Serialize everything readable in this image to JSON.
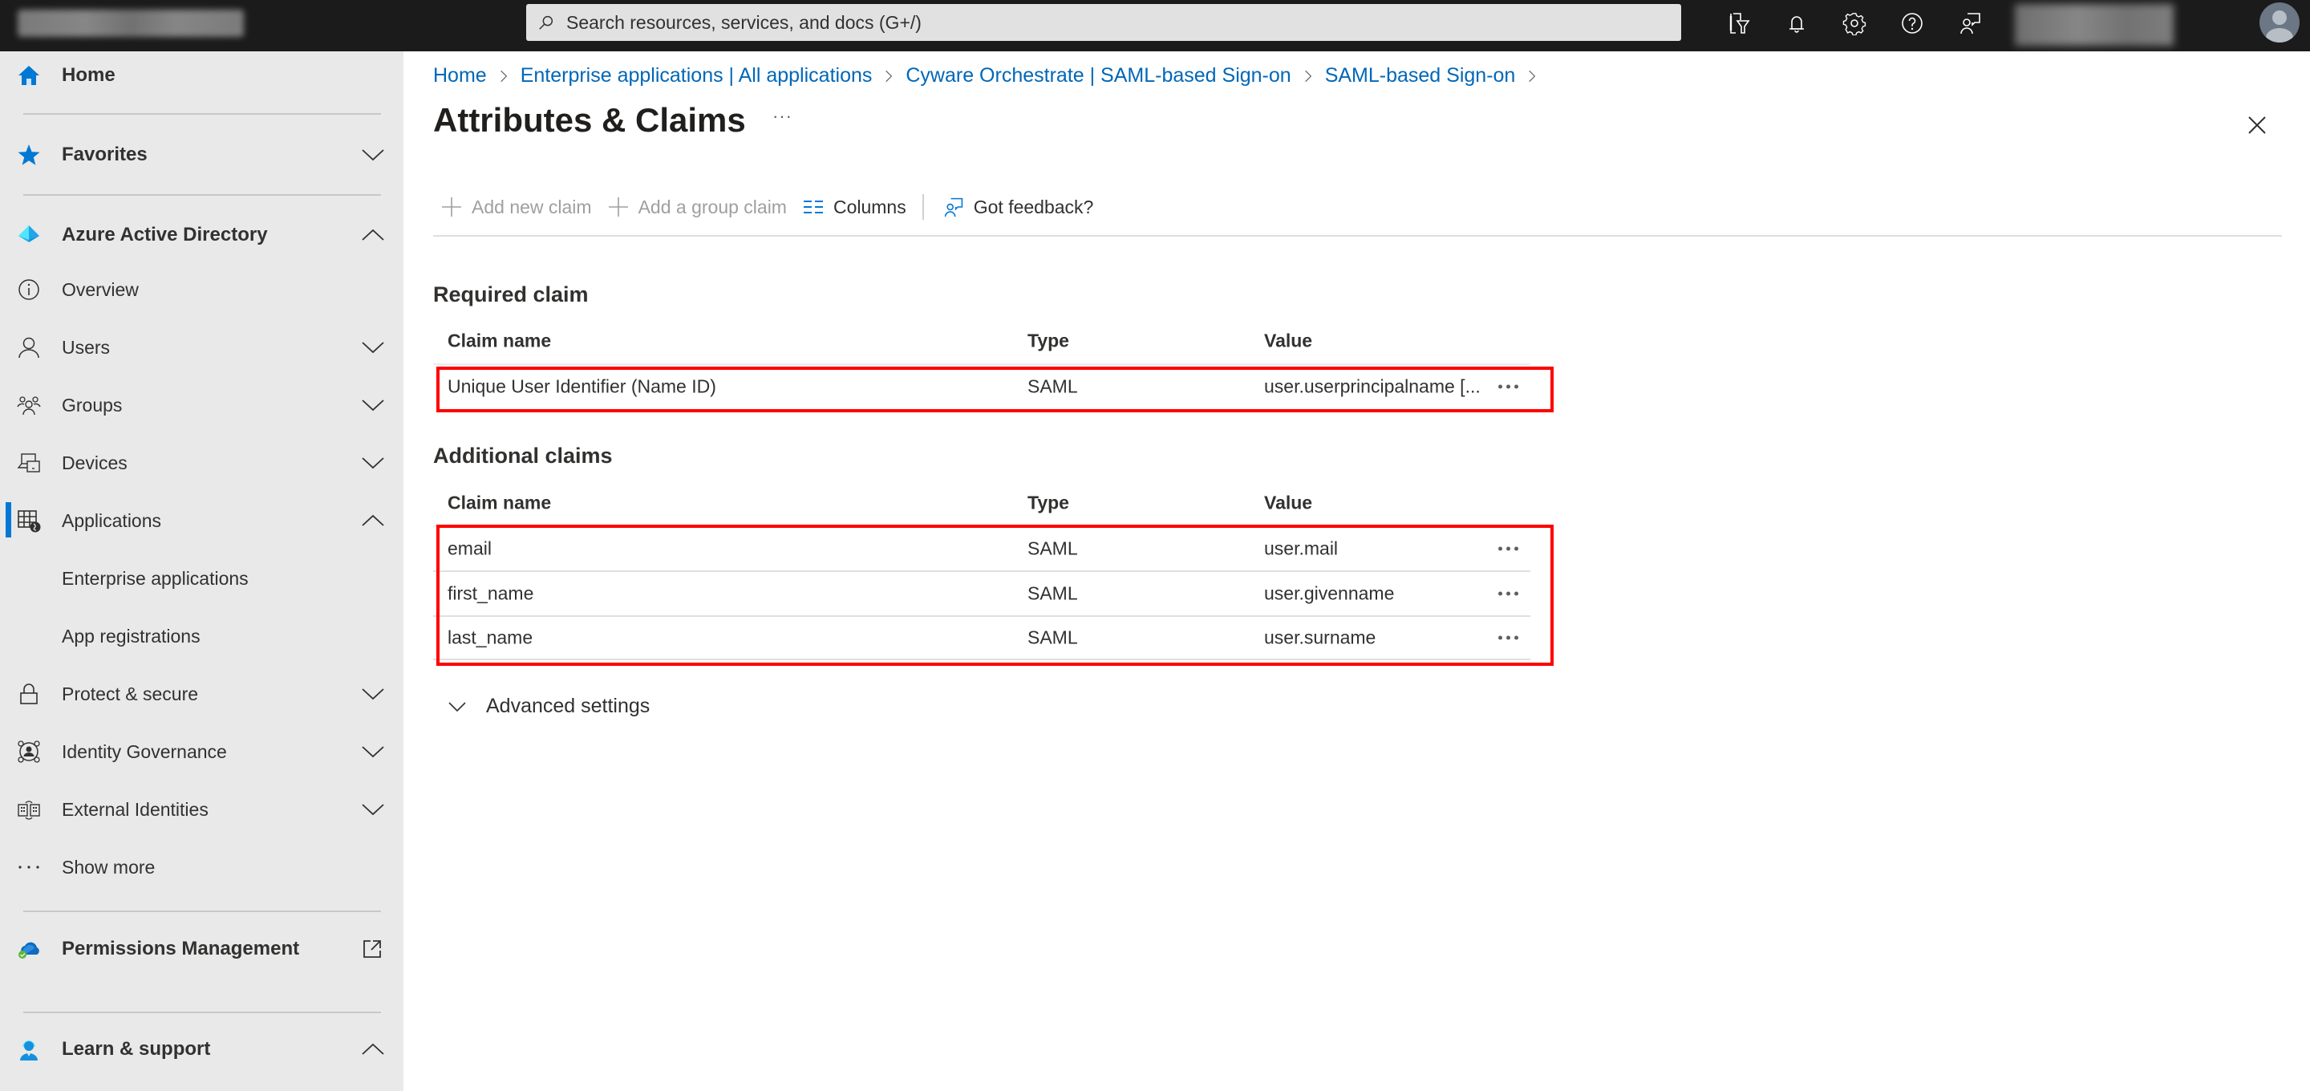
{
  "topbar": {
    "search_placeholder": "Search resources, services, and docs (G+/)",
    "icons": [
      "directory-filter-icon",
      "notification-bell-icon",
      "settings-gear-icon",
      "help-question-icon",
      "feedback-icon"
    ]
  },
  "sidebar": {
    "home": "Home",
    "favorites": "Favorites",
    "aad": "Azure Active Directory",
    "items": [
      {
        "label": "Overview",
        "icon": "info-icon",
        "chevron": "none"
      },
      {
        "label": "Users",
        "icon": "user-icon",
        "chevron": "down"
      },
      {
        "label": "Groups",
        "icon": "groups-icon",
        "chevron": "down"
      },
      {
        "label": "Devices",
        "icon": "devices-icon",
        "chevron": "down"
      },
      {
        "label": "Applications",
        "icon": "applications-icon",
        "chevron": "up",
        "selected": true
      },
      {
        "label": "Enterprise applications",
        "icon": "",
        "chevron": "none"
      },
      {
        "label": "App registrations",
        "icon": "",
        "chevron": "none"
      },
      {
        "label": "Protect & secure",
        "icon": "lock-icon",
        "chevron": "down"
      },
      {
        "label": "Identity Governance",
        "icon": "identity-governance-icon",
        "chevron": "down"
      },
      {
        "label": "External Identities",
        "icon": "external-identities-icon",
        "chevron": "down"
      },
      {
        "label": "Show more",
        "icon": "more-icon",
        "chevron": "none"
      }
    ],
    "permissions": "Permissions Management",
    "learn": "Learn & support"
  },
  "breadcrumb": [
    "Home",
    "Enterprise applications | All applications",
    "Cyware Orchestrate | SAML-based Sign-on",
    "SAML-based Sign-on"
  ],
  "page": {
    "title": "Attributes & Claims",
    "more": "···"
  },
  "toolbar": {
    "add_claim": "Add new claim",
    "add_group_claim": "Add a group claim",
    "columns": "Columns",
    "feedback": "Got feedback?"
  },
  "columns": {
    "name": "Claim name",
    "type": "Type",
    "value": "Value"
  },
  "required": {
    "title": "Required claim",
    "rows": [
      {
        "name": "Unique User Identifier (Name ID)",
        "type": "SAML",
        "value": "user.userprincipalname [..."
      }
    ]
  },
  "additional": {
    "title": "Additional claims",
    "rows": [
      {
        "name": "email",
        "type": "SAML",
        "value": "user.mail"
      },
      {
        "name": "first_name",
        "type": "SAML",
        "value": "user.givenname"
      },
      {
        "name": "last_name",
        "type": "SAML",
        "value": "user.surname"
      }
    ]
  },
  "advanced": "Advanced settings",
  "colors": {
    "accent": "#0078d4",
    "link": "#0067b8",
    "highlight": "#ff0000",
    "topbar": "#1b1b1b",
    "sidebar": "#e9e9e9"
  }
}
